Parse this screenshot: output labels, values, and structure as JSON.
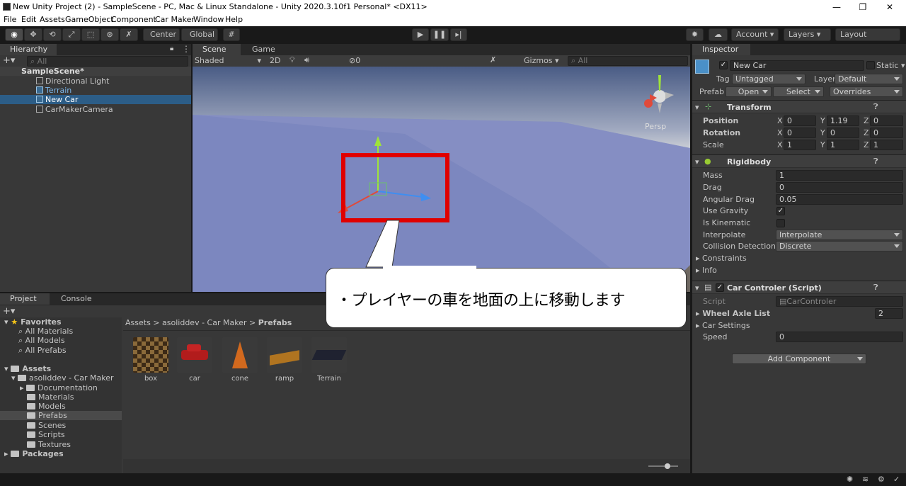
{
  "window": {
    "title": "New Unity Project (2) - SampleScene - PC, Mac & Linux Standalone - Unity 2020.3.10f1 Personal* <DX11>",
    "minimize": "—",
    "maximize": "❐",
    "close": "✕"
  },
  "menu": [
    "File",
    "Edit",
    "Assets",
    "GameObject",
    "Component",
    "Car Maker",
    "Window",
    "Help"
  ],
  "toolbar": {
    "center": "Center",
    "global": "Global",
    "account": "Account",
    "layers": "Layers",
    "layout": "Layout"
  },
  "hierarchy": {
    "tab": "Hierarchy",
    "search_placeholder": "All",
    "scene": "SampleScene*",
    "items": [
      "Directional Light",
      "Terrain",
      "New Car",
      "CarMakerCamera"
    ],
    "selected": "New Car"
  },
  "scene_tabs": {
    "scene": "Scene",
    "game": "Game"
  },
  "scene_toolbar": {
    "shading": "Shaded",
    "mode_2d": "2D",
    "hidden_count": "0",
    "gizmos": "Gizmos",
    "search_placeholder": "All",
    "persp": "Persp"
  },
  "inspector": {
    "tab": "Inspector",
    "object_name": "New Car",
    "static_label": "Static",
    "tag_label": "Tag",
    "tag_value": "Untagged",
    "layer_label": "Layer",
    "layer_value": "Default",
    "prefab_label": "Prefab",
    "open": "Open",
    "select": "Select",
    "overrides": "Overrides",
    "transform": {
      "title": "Transform",
      "position_label": "Position",
      "rotation_label": "Rotation",
      "scale_label": "Scale",
      "position": {
        "x": "0",
        "y": "1.19",
        "z": "0"
      },
      "rotation": {
        "x": "0",
        "y": "0",
        "z": "0"
      },
      "scale": {
        "x": "1",
        "y": "1",
        "z": "1"
      }
    },
    "rigidbody": {
      "title": "Rigidbody",
      "mass_label": "Mass",
      "mass": "1",
      "drag_label": "Drag",
      "drag": "0",
      "angular_drag_label": "Angular Drag",
      "angular_drag": "0.05",
      "use_gravity_label": "Use Gravity",
      "use_gravity": true,
      "is_kinematic_label": "Is Kinematic",
      "is_kinematic": false,
      "interpolate_label": "Interpolate",
      "interpolate": "Interpolate",
      "collision_label": "Collision Detection",
      "collision": "Discrete",
      "constraints_label": "Constraints",
      "info_label": "Info"
    },
    "car_controller": {
      "title": "Car Controler (Script)",
      "script_label": "Script",
      "script_value": "CarControler",
      "wheel_axle_label": "Wheel Axle List",
      "wheel_axle_count": "2",
      "car_settings_label": "Car Settings",
      "speed_label": "Speed",
      "speed": "0"
    },
    "add_component": "Add Component"
  },
  "project": {
    "tab_project": "Project",
    "tab_console": "Console",
    "favorites": "Favorites",
    "fav_items": [
      "All Materials",
      "All Models",
      "All Prefabs"
    ],
    "assets": "Assets",
    "asset_root": "asoliddev - Car Maker",
    "folders": [
      "Documentation",
      "Materials",
      "Models",
      "Prefabs",
      "Scenes",
      "Scripts",
      "Textures"
    ],
    "selected_folder": "Prefabs",
    "packages": "Packages",
    "breadcrumb": [
      "Assets",
      "asoliddev - Car Maker",
      "Prefabs"
    ],
    "prefabs": [
      "box",
      "car",
      "cone",
      "ramp",
      "Terrain"
    ]
  },
  "callout": {
    "text": "・プレイヤーの車を地面の上に移動します",
    "highlight_color": "#e00000"
  }
}
